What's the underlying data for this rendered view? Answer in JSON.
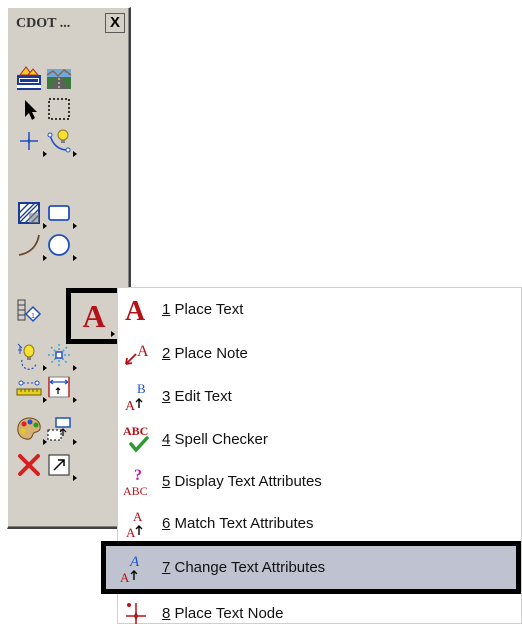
{
  "palette": {
    "title": "CDOT ...",
    "close_label": "X",
    "tools": [
      {
        "name": "cdot-logo-icon"
      },
      {
        "name": "road-image-icon"
      },
      {
        "name": "select-arrow-icon"
      },
      {
        "name": "fence-select-icon"
      },
      {
        "name": "point-tool-icon"
      },
      {
        "name": "lightbulb-curve-icon"
      },
      {
        "name": "hatch-pattern-icon"
      },
      {
        "name": "rectangle-tool-icon"
      },
      {
        "name": "arc-tool-icon"
      },
      {
        "name": "circle-tool-icon"
      },
      {
        "name": "cell-placement-icon"
      },
      {
        "name": "text-tool-icon",
        "glyph": "A",
        "color": "#b51218"
      },
      {
        "name": "tentative-snap-icon"
      },
      {
        "name": "burst-snap-icon"
      },
      {
        "name": "measure-distance-icon"
      },
      {
        "name": "dimension-tool-icon"
      },
      {
        "name": "palette-icon"
      },
      {
        "name": "group-tool-icon"
      },
      {
        "name": "delete-x-icon",
        "color": "#d42020"
      },
      {
        "name": "fit-view-icon"
      }
    ]
  },
  "menu": {
    "items": [
      {
        "num": "1",
        "label": " Place Text",
        "icon": "place-text-icon",
        "glyph": "A"
      },
      {
        "num": "2",
        "label": " Place Note",
        "icon": "place-note-icon",
        "glyph": "A"
      },
      {
        "num": "3",
        "label": " Edit Text",
        "icon": "edit-text-icon",
        "glyph": "A",
        "glyph2": "B"
      },
      {
        "num": "4",
        "label": " Spell Checker",
        "icon": "spell-checker-icon",
        "glyph": "ABC"
      },
      {
        "num": "5",
        "label": " Display Text Attributes",
        "icon": "display-text-attributes-icon",
        "glyph": "ABC",
        "glyph2": "?"
      },
      {
        "num": "6",
        "label": " Match Text Attributes",
        "icon": "match-text-attributes-icon",
        "glyph": "A",
        "glyph2": "A"
      },
      {
        "num": "7",
        "label": " Change Text Attributes",
        "icon": "change-text-attributes-icon",
        "glyph": "A",
        "glyph2": "A",
        "selected": true
      },
      {
        "num": "8",
        "label": " Place Text Node",
        "icon": "place-text-node-icon"
      }
    ]
  },
  "colors": {
    "palette_bg": "#d4d0c8",
    "text_red": "#b51218",
    "selected_bg": "#bfc3cf",
    "check_green": "#2e9a2e",
    "query_magenta": "#c01fa8"
  }
}
